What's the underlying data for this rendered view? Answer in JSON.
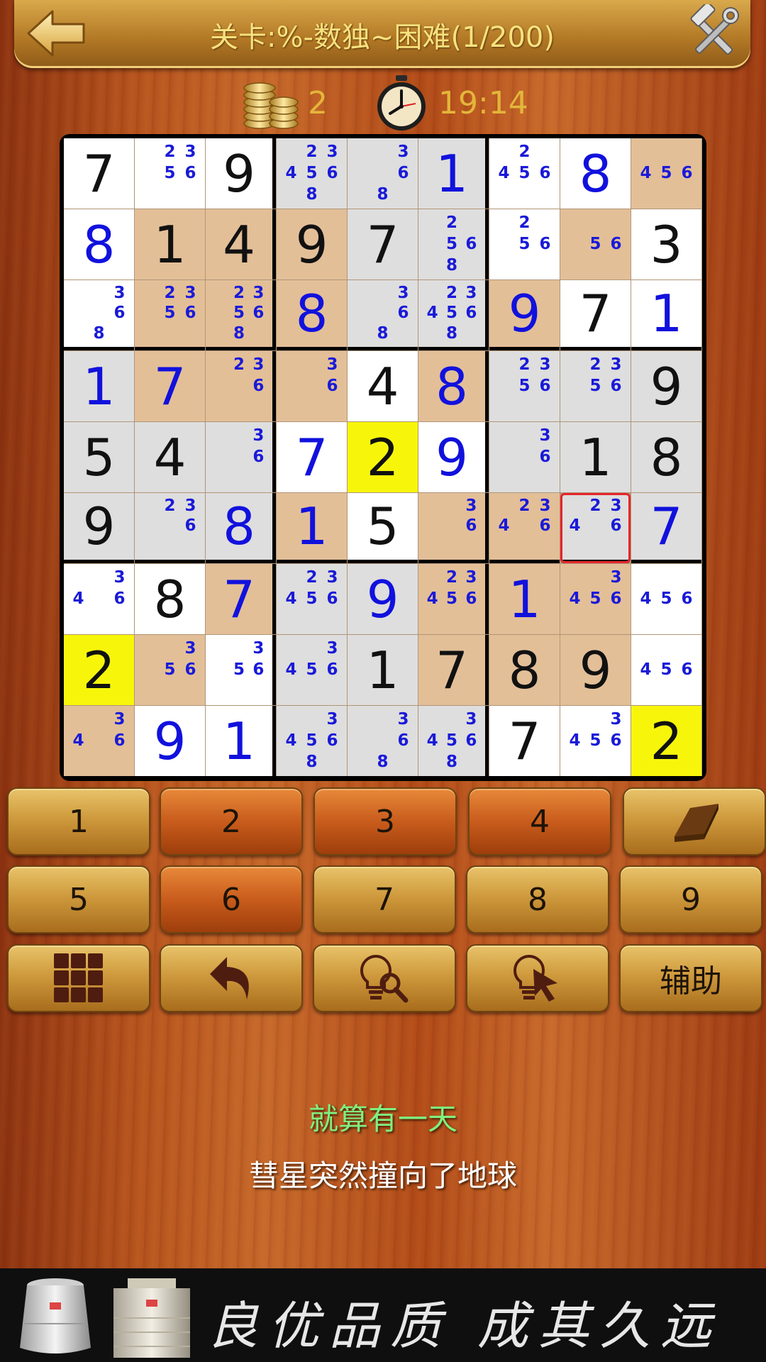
{
  "header": {
    "title": "关卡:%-数独~困难(1/200)"
  },
  "stats": {
    "coins": "2",
    "time": "19:14"
  },
  "board": {
    "rows": [
      [
        {
          "v": "7",
          "k": "given",
          "bg": "white"
        },
        {
          "c": [
            "2",
            "3",
            "5",
            "6"
          ],
          "bg": "white"
        },
        {
          "v": "9",
          "k": "given",
          "bg": "white"
        },
        {
          "c": [
            "2",
            "3",
            "4",
            "5",
            "6",
            "8"
          ],
          "bg": "gray"
        },
        {
          "c": [
            "3",
            "6",
            "8"
          ],
          "bg": "gray"
        },
        {
          "v": "1",
          "k": "entered",
          "bg": "gray"
        },
        {
          "c": [
            "2",
            "4",
            "5",
            "6"
          ],
          "bg": "white"
        },
        {
          "v": "8",
          "k": "entered",
          "bg": "white"
        },
        {
          "c": [
            "4",
            "5",
            "6"
          ],
          "bg": "tan"
        }
      ],
      [
        {
          "v": "8",
          "k": "entered",
          "bg": "white"
        },
        {
          "v": "1",
          "k": "given",
          "bg": "tan"
        },
        {
          "v": "4",
          "k": "given",
          "bg": "tan"
        },
        {
          "v": "9",
          "k": "given",
          "bg": "tan"
        },
        {
          "v": "7",
          "k": "given",
          "bg": "gray"
        },
        {
          "c": [
            "2",
            "5",
            "6",
            "8"
          ],
          "bg": "gray"
        },
        {
          "c": [
            "2",
            "5",
            "6"
          ],
          "bg": "white"
        },
        {
          "c": [
            "5",
            "6"
          ],
          "bg": "tan"
        },
        {
          "v": "3",
          "k": "given",
          "bg": "white"
        }
      ],
      [
        {
          "c": [
            "3",
            "6",
            "8"
          ],
          "bg": "white"
        },
        {
          "c": [
            "2",
            "3",
            "5",
            "6"
          ],
          "bg": "tan"
        },
        {
          "c": [
            "2",
            "3",
            "5",
            "6",
            "8"
          ],
          "bg": "tan"
        },
        {
          "v": "8",
          "k": "entered",
          "bg": "tan"
        },
        {
          "c": [
            "3",
            "6",
            "8"
          ],
          "bg": "gray"
        },
        {
          "c": [
            "2",
            "3",
            "4",
            "5",
            "6",
            "8"
          ],
          "bg": "gray"
        },
        {
          "v": "9",
          "k": "entered",
          "bg": "tan"
        },
        {
          "v": "7",
          "k": "given",
          "bg": "white"
        },
        {
          "v": "1",
          "k": "entered",
          "bg": "white"
        }
      ],
      [
        {
          "v": "1",
          "k": "entered",
          "bg": "gray"
        },
        {
          "v": "7",
          "k": "entered",
          "bg": "tan"
        },
        {
          "c": [
            "2",
            "3",
            "6"
          ],
          "bg": "tan"
        },
        {
          "c": [
            "3",
            "6"
          ],
          "bg": "tan"
        },
        {
          "v": "4",
          "k": "given",
          "bg": "white"
        },
        {
          "v": "8",
          "k": "entered",
          "bg": "tan"
        },
        {
          "c": [
            "2",
            "3",
            "5",
            "6"
          ],
          "bg": "gray"
        },
        {
          "c": [
            "2",
            "3",
            "5",
            "6"
          ],
          "bg": "gray"
        },
        {
          "v": "9",
          "k": "given",
          "bg": "gray"
        }
      ],
      [
        {
          "v": "5",
          "k": "given",
          "bg": "gray"
        },
        {
          "v": "4",
          "k": "given",
          "bg": "gray"
        },
        {
          "c": [
            "3",
            "6"
          ],
          "bg": "gray"
        },
        {
          "v": "7",
          "k": "entered",
          "bg": "white"
        },
        {
          "v": "2",
          "k": "given",
          "bg": "yellow"
        },
        {
          "v": "9",
          "k": "entered",
          "bg": "white"
        },
        {
          "c": [
            "3",
            "6"
          ],
          "bg": "gray"
        },
        {
          "v": "1",
          "k": "given",
          "bg": "gray"
        },
        {
          "v": "8",
          "k": "given",
          "bg": "gray"
        }
      ],
      [
        {
          "v": "9",
          "k": "given",
          "bg": "gray"
        },
        {
          "c": [
            "2",
            "3",
            "6"
          ],
          "bg": "gray"
        },
        {
          "v": "8",
          "k": "entered",
          "bg": "gray"
        },
        {
          "v": "1",
          "k": "entered",
          "bg": "tan"
        },
        {
          "v": "5",
          "k": "given",
          "bg": "white"
        },
        {
          "c": [
            "3",
            "6"
          ],
          "bg": "tan"
        },
        {
          "c": [
            "2",
            "3",
            "4",
            "6"
          ],
          "bg": "tan"
        },
        {
          "c": [
            "2",
            "3",
            "4",
            "6"
          ],
          "bg": "gray",
          "sel": true
        },
        {
          "v": "7",
          "k": "entered",
          "bg": "gray"
        }
      ],
      [
        {
          "c": [
            "3",
            "4",
            "6"
          ],
          "bg": "white"
        },
        {
          "v": "8",
          "k": "given",
          "bg": "white"
        },
        {
          "v": "7",
          "k": "entered",
          "bg": "tan"
        },
        {
          "c": [
            "2",
            "3",
            "4",
            "5",
            "6"
          ],
          "bg": "gray"
        },
        {
          "v": "9",
          "k": "entered",
          "bg": "gray"
        },
        {
          "c": [
            "2",
            "3",
            "4",
            "5",
            "6"
          ],
          "bg": "tan"
        },
        {
          "v": "1",
          "k": "entered",
          "bg": "tan"
        },
        {
          "c": [
            "3",
            "4",
            "5",
            "6"
          ],
          "bg": "tan"
        },
        {
          "c": [
            "4",
            "5",
            "6"
          ],
          "bg": "white"
        }
      ],
      [
        {
          "v": "2",
          "k": "given",
          "bg": "yellow"
        },
        {
          "c": [
            "3",
            "5",
            "6"
          ],
          "bg": "tan"
        },
        {
          "c": [
            "3",
            "5",
            "6"
          ],
          "bg": "white"
        },
        {
          "c": [
            "3",
            "4",
            "5",
            "6"
          ],
          "bg": "gray"
        },
        {
          "v": "1",
          "k": "given",
          "bg": "gray"
        },
        {
          "v": "7",
          "k": "given",
          "bg": "tan"
        },
        {
          "v": "8",
          "k": "given",
          "bg": "tan"
        },
        {
          "v": "9",
          "k": "given",
          "bg": "tan"
        },
        {
          "c": [
            "4",
            "5",
            "6"
          ],
          "bg": "white"
        }
      ],
      [
        {
          "c": [
            "3",
            "4",
            "6"
          ],
          "bg": "tan"
        },
        {
          "v": "9",
          "k": "entered",
          "bg": "white"
        },
        {
          "v": "1",
          "k": "entered",
          "bg": "white"
        },
        {
          "c": [
            "3",
            "4",
            "5",
            "6",
            "8"
          ],
          "bg": "gray"
        },
        {
          "c": [
            "3",
            "6",
            "8"
          ],
          "bg": "gray"
        },
        {
          "c": [
            "3",
            "4",
            "5",
            "6",
            "8"
          ],
          "bg": "gray"
        },
        {
          "v": "7",
          "k": "given",
          "bg": "white"
        },
        {
          "c": [
            "3",
            "4",
            "5",
            "6"
          ],
          "bg": "white"
        },
        {
          "v": "2",
          "k": "given",
          "bg": "yellow"
        }
      ]
    ]
  },
  "keypad": {
    "rows": [
      [
        {
          "label": "1",
          "style": "gold",
          "name": "key-1"
        },
        {
          "label": "2",
          "style": "orange",
          "name": "key-2"
        },
        {
          "label": "3",
          "style": "orange",
          "name": "key-3"
        },
        {
          "label": "4",
          "style": "orange",
          "name": "key-4"
        },
        {
          "label": "",
          "style": "gold",
          "name": "eraser-button",
          "icon": "eraser-icon"
        }
      ],
      [
        {
          "label": "5",
          "style": "gold",
          "name": "key-5"
        },
        {
          "label": "6",
          "style": "orange",
          "name": "key-6"
        },
        {
          "label": "7",
          "style": "gold",
          "name": "key-7"
        },
        {
          "label": "8",
          "style": "gold",
          "name": "key-8"
        },
        {
          "label": "9",
          "style": "gold",
          "name": "key-9"
        }
      ],
      [
        {
          "label": "",
          "style": "gold",
          "name": "notes-grid-button",
          "icon": "grid-icon"
        },
        {
          "label": "",
          "style": "gold",
          "name": "undo-button",
          "icon": "undo-icon"
        },
        {
          "label": "",
          "style": "gold",
          "name": "hint-search-button",
          "icon": "bulb-search-icon"
        },
        {
          "label": "",
          "style": "gold",
          "name": "hint-pointer-button",
          "icon": "bulb-pointer-icon"
        },
        {
          "label": "辅助",
          "style": "gold",
          "name": "assist-button"
        }
      ]
    ]
  },
  "lyrics": {
    "line1": "就算有一天",
    "line2": "彗星突然撞向了地球"
  },
  "ad": {
    "slogan": "良优品质  成其久远"
  },
  "colors": {
    "given_digit": "#111111",
    "entered_digit": "#1111dd",
    "candidate": "#1a1ad8",
    "cell_white": "#ffffff",
    "cell_gray": "#dedede",
    "cell_tan": "#e3bf98",
    "cell_highlight": "#f7f60a",
    "selection": "#e4262a",
    "lyric_line1": "#7ff07e",
    "title_text": "#f7e27e"
  }
}
